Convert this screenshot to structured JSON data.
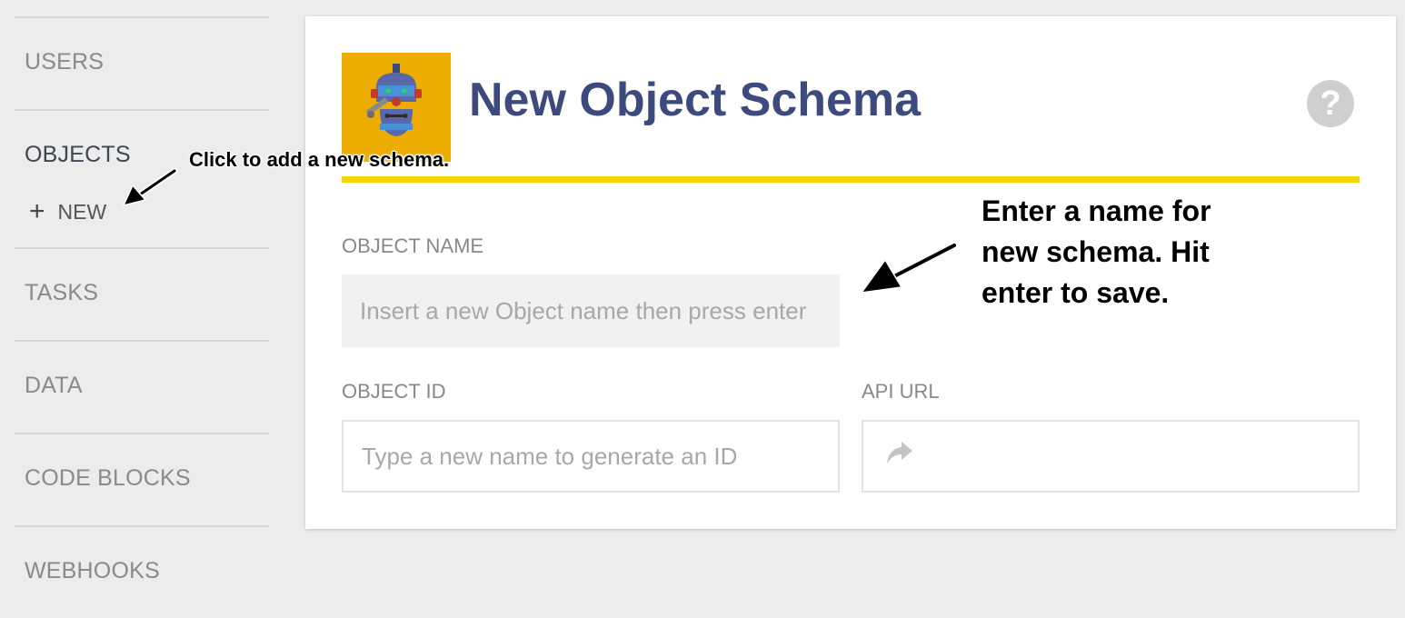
{
  "sidebar": {
    "items": [
      {
        "label": "USERS"
      },
      {
        "label": "OBJECTS"
      },
      {
        "label": "TASKS"
      },
      {
        "label": "DATA"
      },
      {
        "label": "CODE BLOCKS"
      },
      {
        "label": "WEBHOOKS"
      }
    ],
    "new_label": "NEW",
    "new_icon": "plus-icon"
  },
  "card": {
    "title": "New Object Schema",
    "help_symbol": "?",
    "accent_color": "#f7d600",
    "logo_bg": "#ecad00",
    "object_name": {
      "label": "OBJECT NAME",
      "placeholder": "Insert a new Object name then press enter",
      "value": ""
    },
    "object_id": {
      "label": "OBJECT ID",
      "placeholder": "Type a new name to generate an ID",
      "value": ""
    },
    "api_url": {
      "label": "API URL",
      "icon": "share-arrow-icon",
      "value": ""
    }
  },
  "annotations": {
    "new_hint": "Click to add a new schema.",
    "name_hint": "Enter a name for new schema. Hit enter to save."
  }
}
